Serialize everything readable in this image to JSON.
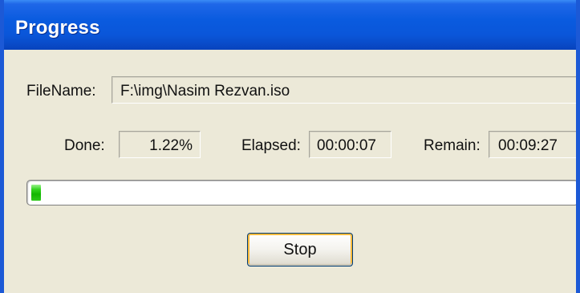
{
  "window": {
    "title": "Progress"
  },
  "file": {
    "label": "FileName:",
    "value": "F:\\img\\Nasim Rezvan.iso"
  },
  "done": {
    "label": "Done:",
    "value": "1.22%"
  },
  "elapsed": {
    "label": "Elapsed:",
    "value": "00:00:07"
  },
  "remain": {
    "label": "Remain:",
    "value": "00:09:27"
  },
  "progress": {
    "percent": 1.22,
    "color": "#12b600"
  },
  "buttons": {
    "stop_label": "Stop"
  },
  "colors": {
    "titlebar": "#0a56d9",
    "face": "#ece9d8",
    "border": "#1c59d6"
  }
}
